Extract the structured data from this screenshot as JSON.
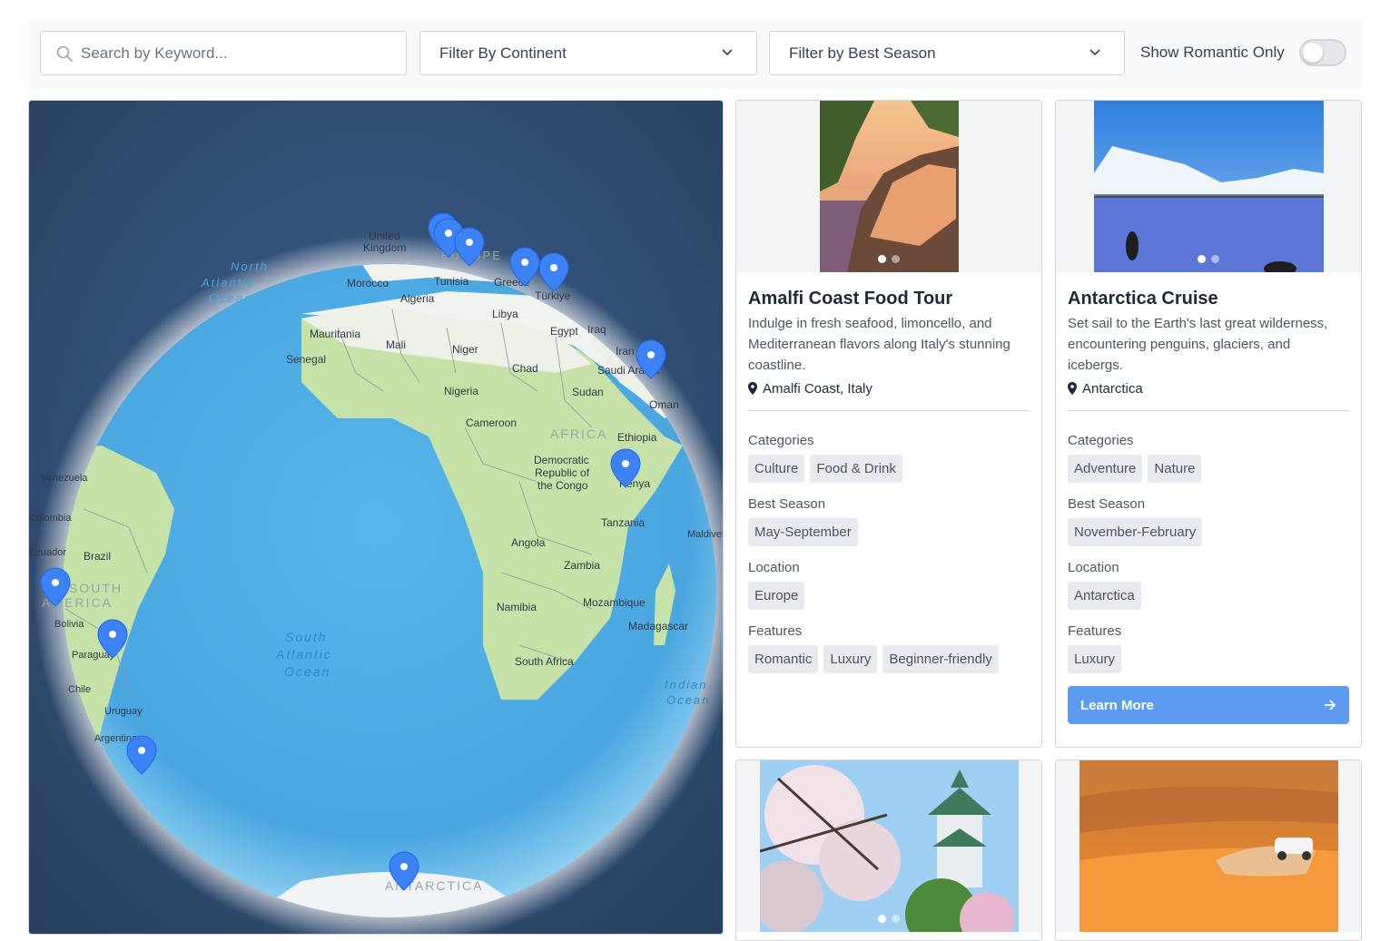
{
  "filters": {
    "search_placeholder": "Search by Keyword...",
    "continent_label": "Filter By Continent",
    "season_label": "Filter by Best Season",
    "romantic_label": "Show Romantic Only",
    "romantic_on": false
  },
  "map": {
    "labels": {
      "north_atlantic": [
        "North",
        "Atlantic",
        "Ocean"
      ],
      "south_atlantic": [
        "South",
        "Atlantic",
        "Ocean"
      ],
      "indian": [
        "Indian",
        "Ocean"
      ],
      "africa": "AFRICA",
      "south_america": [
        "SOUTH",
        "AMERICA"
      ],
      "europe": "EUROPE",
      "antarctica": "ANTARCTICA",
      "united_kingdom": [
        "United",
        "Kingdom"
      ],
      "morocco": "Morocco",
      "tunisia": "Tunisia",
      "algeria": "Algeria",
      "libya": "Libya",
      "greece": "Greece",
      "turkiye": "Türkiye",
      "egypt": "Egypt",
      "iraq": "Iraq",
      "iran": "Iran",
      "saudi": "Saudi Arabia",
      "oman": "Oman",
      "mauritania": "Mauritania",
      "mali": "Mali",
      "niger": "Niger",
      "senegal": "Senegal",
      "chad": "Chad",
      "sudan": "Sudan",
      "nigeria": "Nigeria",
      "cameroon": "Cameroon",
      "ethiopia": "Ethiopia",
      "drc": [
        "Democratic",
        "Republic of",
        "the Congo"
      ],
      "kenya": "Kenya",
      "tanzania": "Tanzania",
      "maldives": "Maldives",
      "angola": "Angola",
      "zambia": "Zambia",
      "namibia": "Namibia",
      "mozambique": "Mozambique",
      "madagascar": "Madagascar",
      "south_africa": "South Africa",
      "venezuela": "Venezuela",
      "colombia": "Colombia",
      "ecuador": "Ecuador",
      "brazil": "Brazil",
      "bolivia": "Bolivia",
      "paraguay": "Paraguay",
      "chile": "Chile",
      "uruguay": "Uruguay",
      "argentina": "Argentina"
    },
    "markers": [
      "marker-europe-1",
      "marker-europe-2",
      "marker-europe-3",
      "marker-greece",
      "marker-turkiye",
      "marker-oman",
      "marker-kenya",
      "marker-peru",
      "marker-paraguay",
      "marker-patagonia",
      "marker-antarctica"
    ],
    "colors": {
      "marker": "#3b82f6",
      "ocean": "#54b3e8",
      "land": "#c3e0a8",
      "space": "#2c4466"
    }
  },
  "cards": [
    {
      "title": "Amalfi Coast Food Tour",
      "description": "Indulge in fresh seafood, limoncello, and Mediterranean flavors along Italy's stunning coastline.",
      "location": "Amalfi Coast, Italy",
      "categories_label": "Categories",
      "categories": [
        "Culture",
        "Food & Drink"
      ],
      "season_label": "Best Season",
      "season": [
        "May-September"
      ],
      "location_label": "Location",
      "location_tags": [
        "Europe"
      ],
      "features_label": "Features",
      "features": [
        "Romantic",
        "Luxury",
        "Beginner-friendly"
      ]
    },
    {
      "title": "Antarctica Cruise",
      "description": "Set sail to the Earth's last great wilderness, encountering penguins, glaciers, and icebergs.",
      "location": "Antarctica",
      "categories_label": "Categories",
      "categories": [
        "Adventure",
        "Nature"
      ],
      "season_label": "Best Season",
      "season": [
        "November-February"
      ],
      "location_label": "Location",
      "location_tags": [
        "Antarctica"
      ],
      "features_label": "Features",
      "features": [
        "Luxury"
      ],
      "button_label": "Learn More"
    }
  ]
}
